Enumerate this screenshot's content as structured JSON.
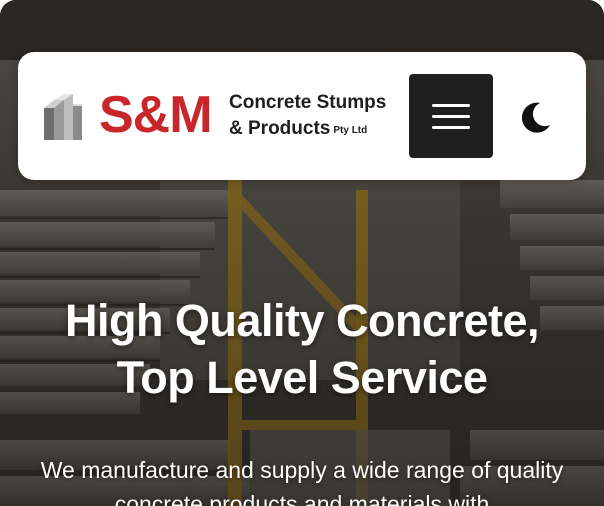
{
  "header": {
    "logo": {
      "mark": "S&M",
      "line1": "Concrete Stumps",
      "line2": "& Products",
      "suffix": "Pty Ltd"
    },
    "menu_icon": "hamburger-menu-icon",
    "theme_icon": "moon-icon"
  },
  "hero": {
    "title_line1": "High Quality Concrete,",
    "title_line2": "Top Level Service",
    "text": "We manufacture and supply a wide range of quality concrete products and materials with"
  },
  "colors": {
    "brand_red": "#c8262b",
    "menu_button_bg": "#1f1f1f",
    "header_bg": "#ffffff",
    "hero_text": "#ffffff"
  }
}
